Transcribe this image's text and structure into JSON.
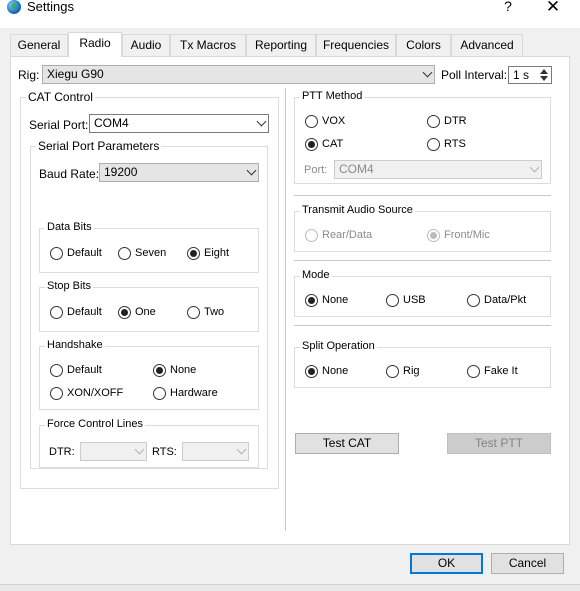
{
  "window": {
    "title": "Settings",
    "help_label": "?",
    "close_label": "✕"
  },
  "tabs": [
    "General",
    "Radio",
    "Audio",
    "Tx Macros",
    "Reporting",
    "Frequencies",
    "Colors",
    "Advanced"
  ],
  "active_tab": "Radio",
  "rig": {
    "label": "Rig:",
    "value": "Xiegu G90"
  },
  "poll": {
    "label": "Poll Interval:",
    "value": "1 s"
  },
  "cat": {
    "title": "CAT Control",
    "serial_port_label": "Serial Port:",
    "serial_port_value": "COM4",
    "params_title": "Serial Port Parameters",
    "baud_label": "Baud Rate:",
    "baud_value": "19200",
    "data_bits": {
      "title": "Data Bits",
      "options": [
        "Default",
        "Seven",
        "Eight"
      ],
      "selected": "Eight"
    },
    "stop_bits": {
      "title": "Stop Bits",
      "options": [
        "Default",
        "One",
        "Two"
      ],
      "selected": "One"
    },
    "handshake": {
      "title": "Handshake",
      "options": [
        "Default",
        "None",
        "XON/XOFF",
        "Hardware"
      ],
      "selected": "None"
    },
    "force": {
      "title": "Force Control Lines",
      "dtr_label": "DTR:",
      "dtr_value": "",
      "rts_label": "RTS:",
      "rts_value": ""
    }
  },
  "ptt": {
    "title": "PTT Method",
    "options": [
      "VOX",
      "DTR",
      "CAT",
      "RTS"
    ],
    "selected": "CAT",
    "port_label": "Port:",
    "port_value": "COM4"
  },
  "audio_source": {
    "title": "Transmit Audio Source",
    "options": [
      "Rear/Data",
      "Front/Mic"
    ],
    "selected": "Front/Mic"
  },
  "mode": {
    "title": "Mode",
    "options": [
      "None",
      "USB",
      "Data/Pkt"
    ],
    "selected": "None"
  },
  "split": {
    "title": "Split Operation",
    "options": [
      "None",
      "Rig",
      "Fake It"
    ],
    "selected": "None"
  },
  "buttons": {
    "test_cat": "Test CAT",
    "test_ptt": "Test PTT",
    "ok": "OK",
    "cancel": "Cancel"
  },
  "colors": {
    "focus_blue": "#0078d7",
    "panel_bg": "#ffffff",
    "window_bg": "#f0f0f0"
  }
}
